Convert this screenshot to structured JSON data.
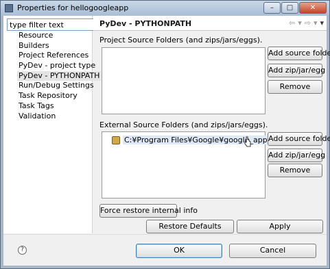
{
  "window": {
    "title": "Properties for hellogoogleapp",
    "minimize": "–",
    "maximize": "□",
    "close": "✕"
  },
  "filter": {
    "placeholder": "type filter text",
    "value": "type filter text"
  },
  "nav": {
    "items": [
      {
        "label": "Resource"
      },
      {
        "label": "Builders"
      },
      {
        "label": "Project References"
      },
      {
        "label": "PyDev - project type"
      },
      {
        "label": "PyDev - PYTHONPATH",
        "selected": true
      },
      {
        "label": "Run/Debug Settings"
      },
      {
        "label": "Task Repository"
      },
      {
        "label": "Task Tags"
      },
      {
        "label": "Validation"
      }
    ]
  },
  "page": {
    "title": "PyDev - PYTHONPATH",
    "back_icon": "⇦",
    "forward_icon": "⇨",
    "menu_icon": "▾"
  },
  "project_sources": {
    "label": "Project Source Folders (and zips/jars/eggs).",
    "add_folder": "Add source folder",
    "add_zip": "Add zip/jar/egg",
    "remove": "Remove"
  },
  "external_sources": {
    "label": "External Source Folders (and zips/jars/eggs).",
    "entries": [
      "C:¥Program Files¥Google¥google_appengine"
    ],
    "add_folder": "Add source folder",
    "add_zip": "Add zip/jar/egg",
    "remove": "Remove"
  },
  "buttons": {
    "force_restore": "Force restore internal info",
    "restore_defaults": "Restore Defaults",
    "apply": "Apply",
    "ok": "OK",
    "cancel": "Cancel",
    "help": "?"
  },
  "colors": {
    "frame": "#aab7c6",
    "client_bg": "#f0f0f0",
    "default_button_border": "#3c7fb1",
    "selected_entry_bg": "#dfe9f5"
  }
}
